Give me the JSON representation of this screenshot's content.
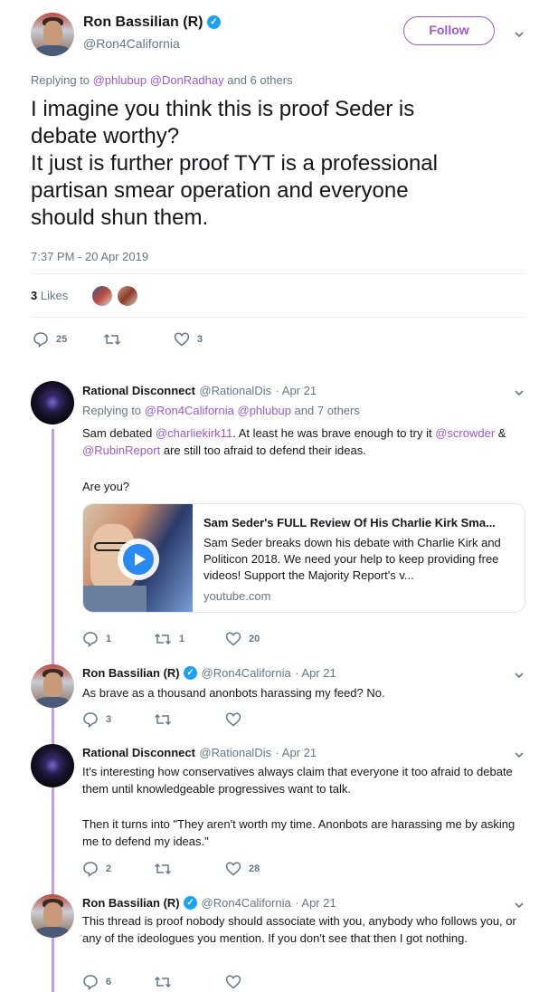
{
  "main_tweet": {
    "name": "Ron Bassilian (R)",
    "handle": "@Ron4California",
    "follow_label": "Follow",
    "replying_prefix": "Replying to",
    "replying_users": [
      "@phlubup",
      "@DonRadhay"
    ],
    "replying_suffix": "and 6 others",
    "text_lines": [
      "I imagine you think this is proof Seder is",
      "debate worthy?",
      "It just is further proof TYT is a professional",
      "partisan smear operation and everyone",
      "should shun them."
    ],
    "timestamp": "7:37 PM - 20 Apr 2019",
    "likes_count": "3",
    "likes_label": "Likes",
    "replies": "25",
    "retweets": "",
    "likes": "3"
  },
  "replies": [
    {
      "name": "Rational Disconnect",
      "handle": "@RationalDis",
      "date": "· Apr 21",
      "replying_prefix": "Replying to",
      "replying_users": [
        "@Ron4California",
        "@phlubup"
      ],
      "replying_suffix": "and 7 others",
      "text_parts": {
        "p1": "Sam debated",
        "m1": "@charliekirk11",
        "p2": ". At least he was brave enough to try it",
        "m2": "@scrowder",
        "p3": "&",
        "m3": "@RubinReport",
        "p4": "are still too afraid to defend their ideas."
      },
      "text_line2": "Are you?",
      "card": {
        "title": "Sam Seder's FULL Review Of His Charlie Kirk Sma...",
        "description": "Sam Seder breaks down his debate with Charlie Kirk and Politicon 2018. We need your help to keep providing free videos! Support the Majority Report's v...",
        "domain": "youtube.com"
      },
      "replies": "1",
      "retweets": "1",
      "likes": "20"
    },
    {
      "name": "Ron Bassilian (R)",
      "handle": "@Ron4California",
      "date": "· Apr 21",
      "text": "As brave as a thousand anonbots harassing my feed? No.",
      "replies": "3",
      "retweets": "",
      "likes": ""
    },
    {
      "name": "Rational Disconnect",
      "handle": "@RationalDis",
      "date": "· Apr 21",
      "text_p1": "It's interesting how conservatives always claim that everyone it too afraid to debate them until knowledgeable progressives want to talk.",
      "text_p2": "Then it turns into \"They aren't worth my time. Anonbots are harassing me by asking me to defend my ideas.\"",
      "replies": "2",
      "retweets": "",
      "likes": "28"
    },
    {
      "name": "Ron Bassilian (R)",
      "handle": "@Ron4California",
      "date": "· Apr 21",
      "text": "This thread is proof nobody should associate with you, anybody who follows you, or any of the ideologues you mention. If you don't see that then I got nothing.",
      "replies": "6",
      "retweets": "",
      "likes": ""
    }
  ],
  "colors": {
    "link": "#9b59d0",
    "muted": "#657786",
    "thread_line": "#c69ce8",
    "verified": "#1da1f2"
  }
}
